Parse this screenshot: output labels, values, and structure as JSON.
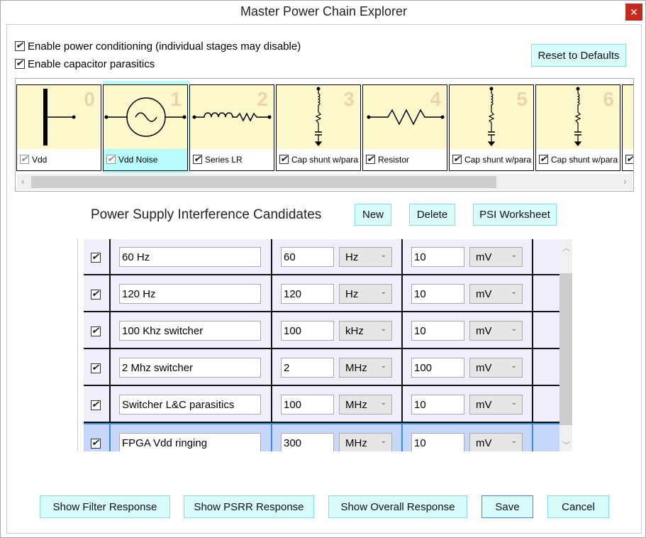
{
  "window": {
    "title": "Master Power Chain Explorer",
    "close_icon": "close-icon"
  },
  "options": [
    {
      "label": "Enable power conditioning (individual stages may disable)",
      "checked": true
    },
    {
      "label": "Enable capacitor parasitics",
      "checked": true
    }
  ],
  "reset_label": "Reset to Defaults",
  "stages": [
    {
      "index": "0",
      "label": "Vdd",
      "checked": true,
      "disabled": true,
      "icon": "vdd-rail-icon"
    },
    {
      "index": "1",
      "label": "Vdd Noise",
      "checked": true,
      "disabled": true,
      "selected": true,
      "icon": "ac-source-icon"
    },
    {
      "index": "2",
      "label": "Series LR",
      "checked": true,
      "icon": "inductor-resistor-icon"
    },
    {
      "index": "3",
      "label": "Cap shunt w/paras",
      "checked": true,
      "icon": "cap-shunt-icon"
    },
    {
      "index": "4",
      "label": "Resistor",
      "checked": true,
      "icon": "resistor-icon"
    },
    {
      "index": "5",
      "label": "Cap shunt w/paras",
      "checked": true,
      "icon": "cap-shunt-icon"
    },
    {
      "index": "6",
      "label": "Cap shunt w/paras",
      "checked": true,
      "icon": "cap-shunt-icon"
    }
  ],
  "psi": {
    "heading": "Power Supply Interference Candidates",
    "new_label": "New",
    "delete_label": "Delete",
    "worksheet_label": "PSI Worksheet",
    "rows": [
      {
        "enabled": true,
        "name": "60 Hz",
        "freq": "60",
        "freq_unit": "Hz",
        "amp": "10",
        "amp_unit": "mV"
      },
      {
        "enabled": true,
        "name": "120 Hz",
        "freq": "120",
        "freq_unit": "Hz",
        "amp": "10",
        "amp_unit": "mV"
      },
      {
        "enabled": true,
        "name": "100 Khz switcher",
        "freq": "100",
        "freq_unit": "kHz",
        "amp": "10",
        "amp_unit": "mV"
      },
      {
        "enabled": true,
        "name": "2 Mhz switcher",
        "freq": "2",
        "freq_unit": "MHz",
        "amp": "100",
        "amp_unit": "mV"
      },
      {
        "enabled": true,
        "name": "Switcher L&C parasitics",
        "freq": "100",
        "freq_unit": "MHz",
        "amp": "10",
        "amp_unit": "mV"
      },
      {
        "enabled": true,
        "name": "FPGA Vdd ringing",
        "freq": "300",
        "freq_unit": "MHz",
        "amp": "10",
        "amp_unit": "mV",
        "selected": true
      }
    ]
  },
  "footer": {
    "filter": "Show Filter Response",
    "psrr": "Show PSRR Response",
    "overall": "Show Overall Response",
    "save": "Save",
    "cancel": "Cancel"
  }
}
